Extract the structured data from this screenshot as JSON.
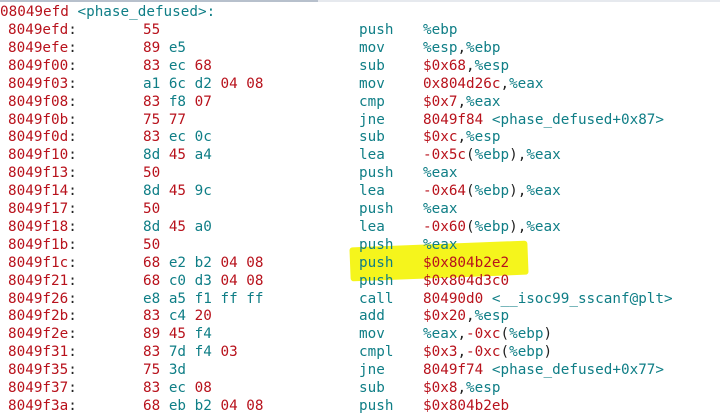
{
  "header": {
    "address": "08049efd",
    "symbol": "<phase_defused>:"
  },
  "colors": {
    "address": "#b8121c",
    "mnemonic": "#0f7e86",
    "highlight": "#f5f51c"
  },
  "highlighted_row_index": 14,
  "rows": [
    {
      "addr": "8049efd",
      "bytes": "55",
      "mnem": "push",
      "ops": "%ebp",
      "sym": ""
    },
    {
      "addr": "8049efe",
      "bytes": "89 e5",
      "mnem": "mov",
      "ops": "%esp,%ebp",
      "sym": ""
    },
    {
      "addr": "8049f00",
      "bytes": "83 ec 68",
      "mnem": "sub",
      "ops": "$0x68,%esp",
      "sym": ""
    },
    {
      "addr": "8049f03",
      "bytes": "a1 6c d2 04 08",
      "mnem": "mov",
      "ops": "0x804d26c,%eax",
      "sym": ""
    },
    {
      "addr": "8049f08",
      "bytes": "83 f8 07",
      "mnem": "cmp",
      "ops": "$0x7,%eax",
      "sym": ""
    },
    {
      "addr": "8049f0b",
      "bytes": "75 77",
      "mnem": "jne",
      "ops": "8049f84 ",
      "sym": "<phase_defused+0x87>"
    },
    {
      "addr": "8049f0d",
      "bytes": "83 ec 0c",
      "mnem": "sub",
      "ops": "$0xc,%esp",
      "sym": ""
    },
    {
      "addr": "8049f10",
      "bytes": "8d 45 a4",
      "mnem": "lea",
      "ops": "-0x5c(%ebp),%eax",
      "sym": ""
    },
    {
      "addr": "8049f13",
      "bytes": "50",
      "mnem": "push",
      "ops": "%eax",
      "sym": ""
    },
    {
      "addr": "8049f14",
      "bytes": "8d 45 9c",
      "mnem": "lea",
      "ops": "-0x64(%ebp),%eax",
      "sym": ""
    },
    {
      "addr": "8049f17",
      "bytes": "50",
      "mnem": "push",
      "ops": "%eax",
      "sym": ""
    },
    {
      "addr": "8049f18",
      "bytes": "8d 45 a0",
      "mnem": "lea",
      "ops": "-0x60(%ebp),%eax",
      "sym": ""
    },
    {
      "addr": "8049f1b",
      "bytes": "50",
      "mnem": "push",
      "ops": "%eax",
      "sym": ""
    },
    {
      "addr": "8049f1c",
      "bytes": "68 e2 b2 04 08",
      "mnem": "push",
      "ops": "$0x804b2e2",
      "sym": ""
    },
    {
      "addr": "8049f21",
      "bytes": "68 c0 d3 04 08",
      "mnem": "push",
      "ops": "$0x804d3c0",
      "sym": ""
    },
    {
      "addr": "8049f26",
      "bytes": "e8 a5 f1 ff ff",
      "mnem": "call",
      "ops": "80490d0 ",
      "sym": "<__isoc99_sscanf@plt>"
    },
    {
      "addr": "8049f2b",
      "bytes": "83 c4 20",
      "mnem": "add",
      "ops": "$0x20,%esp",
      "sym": ""
    },
    {
      "addr": "8049f2e",
      "bytes": "89 45 f4",
      "mnem": "mov",
      "ops": "%eax,-0xc(%ebp)",
      "sym": ""
    },
    {
      "addr": "8049f31",
      "bytes": "83 7d f4 03",
      "mnem": "cmpl",
      "ops": "$0x3,-0xc(%ebp)",
      "sym": ""
    },
    {
      "addr": "8049f35",
      "bytes": "75 3d",
      "mnem": "jne",
      "ops": "8049f74 ",
      "sym": "<phase_defused+0x77>"
    },
    {
      "addr": "8049f37",
      "bytes": "83 ec 08",
      "mnem": "sub",
      "ops": "$0x8,%esp",
      "sym": ""
    },
    {
      "addr": "8049f3a",
      "bytes": "68 eb b2 04 08",
      "mnem": "push",
      "ops": "$0x804b2eb",
      "sym": ""
    }
  ]
}
